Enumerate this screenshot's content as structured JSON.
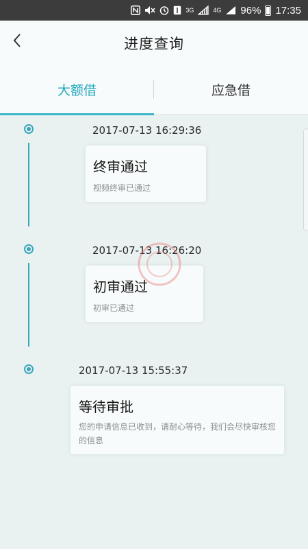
{
  "status_bar": {
    "network_3g": "3G",
    "network_4g": "4G",
    "battery_percent": "96%",
    "time": "17:35"
  },
  "header": {
    "title": "进度查询"
  },
  "tabs": [
    {
      "label": "大额借",
      "active": true
    },
    {
      "label": "应急借",
      "active": false
    }
  ],
  "timeline": [
    {
      "time": "2017-07-13 16:29:36",
      "status": "终审通过",
      "description": "视频终审已通过"
    },
    {
      "time": "2017-07-13 16:26:20",
      "status": "初审通过",
      "description": "初审已通过"
    },
    {
      "time": "2017-07-13 15:55:37",
      "status": "等待审批",
      "description": "您的申请信息已收到，请耐心等待，我们会尽快审核您的信息"
    }
  ],
  "colors": {
    "accent": "#39b5c9",
    "background": "#eaf1f1",
    "status_bar": "#3c3c3c"
  }
}
